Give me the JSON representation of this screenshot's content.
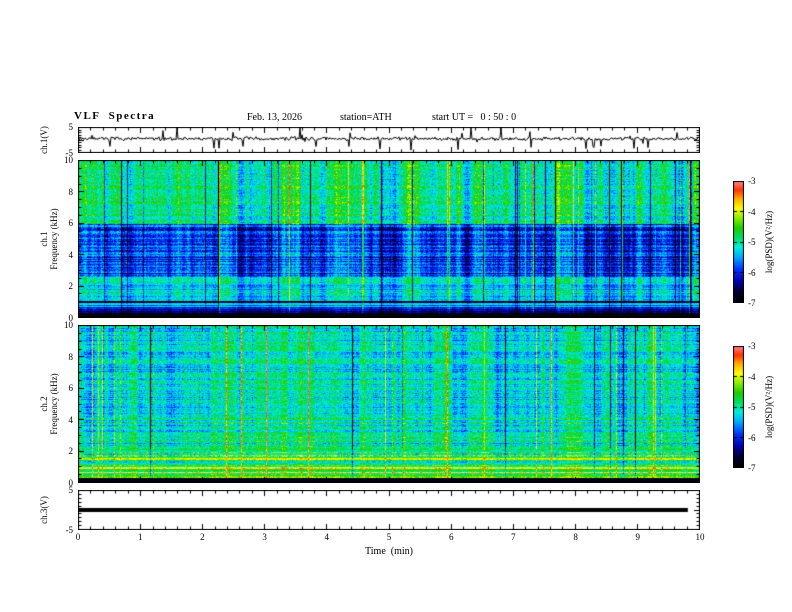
{
  "header": {
    "title": "VLF  Spectra",
    "date": "Feb. 13, 2026",
    "station": "station=ATH",
    "start_ut": "start UT =   0 : 50 : 0"
  },
  "axes": {
    "xlabel": "Time  (min)",
    "xlim": [
      0,
      10
    ],
    "xticks": [
      0,
      1,
      2,
      3,
      4,
      5,
      6,
      7,
      8,
      9,
      10
    ]
  },
  "colorbar": {
    "label": "log(PSD)(V²/Hz)",
    "ticks": [
      -3,
      -4,
      -5,
      -6,
      -7
    ],
    "zlim": [
      -7,
      -3
    ],
    "stops": [
      {
        "t": 0.0,
        "c": "#000000"
      },
      {
        "t": 0.1,
        "c": "#000033"
      },
      {
        "t": 0.18,
        "c": "#0000aa"
      },
      {
        "t": 0.28,
        "c": "#0033ff"
      },
      {
        "t": 0.38,
        "c": "#00aaff"
      },
      {
        "t": 0.46,
        "c": "#00eedd"
      },
      {
        "t": 0.54,
        "c": "#00e066"
      },
      {
        "t": 0.62,
        "c": "#22cc00"
      },
      {
        "t": 0.7,
        "c": "#88ee00"
      },
      {
        "t": 0.78,
        "c": "#ffff00"
      },
      {
        "t": 0.86,
        "c": "#ffaa00"
      },
      {
        "t": 0.93,
        "c": "#ff3300"
      },
      {
        "t": 1.0,
        "c": "#ff8888"
      }
    ]
  },
  "chart_data": [
    {
      "type": "line",
      "name": "ch1-voltage-waveform",
      "ylabel": "ch.1(V)",
      "ylim": [
        -5,
        5
      ],
      "yticks": [
        5,
        -5
      ],
      "xlim_min": [
        0,
        10
      ],
      "summary": "Noisy broadband voltage trace hovering near +0.5 V with frequent impulsive spikes (sferics) reaching toward +5 and -5 V across the full 10 minutes",
      "gen": {
        "seed": 7,
        "baseline": 0.5,
        "noise": 0.4,
        "spike_prob": 0.06,
        "spike_min": 1.2,
        "spike_max": 4.6,
        "neg_frac": 0.6
      }
    },
    {
      "type": "heatmap",
      "name": "ch1-spectrogram",
      "ylabel_lines": [
        "ch.1",
        "Frequency (kHz)"
      ],
      "ylim": [
        0,
        10
      ],
      "yticks": [
        0,
        2,
        4,
        6,
        8,
        10
      ],
      "zlim": [
        -7,
        -3
      ],
      "zlabel": "log(PSD)(V²/Hz)",
      "summary": "0-10 kHz spectrogram, 0-10 min: green band (~-5) above 6 kHz with dense vertical sferic striping (yellow bright / dark dropout columns), darker blue band (~-5.9) from ~2.5-6 kHz, cyan band (~-5.2) from ~1-2.5 kHz, mixed black and colored power-line harmonics below 1 kHz, near-black (~-7) floor under 0.35 kHz",
      "gen": {
        "seed": 21,
        "bands": [
          {
            "f0": 0.0,
            "f1": 0.35,
            "base": -6.9,
            "hvar": 0.1,
            "pvar": 0.05,
            "stripe": 0.1
          },
          {
            "f0": 0.35,
            "f1": 1.1,
            "base": -6.0,
            "hvar": 0.9,
            "pvar": 0.2,
            "stripe": 0.4
          },
          {
            "f0": 1.1,
            "f1": 2.6,
            "base": -5.25,
            "hvar": 0.35,
            "pvar": 0.25,
            "stripe": 0.8
          },
          {
            "f0": 2.6,
            "f1": 6.0,
            "base": -5.85,
            "hvar": 0.4,
            "pvar": 0.3,
            "stripe": 0.9
          },
          {
            "f0": 6.0,
            "f1": 10.0,
            "base": -4.95,
            "hvar": 0.25,
            "pvar": 0.3,
            "stripe": 1.0
          }
        ],
        "stripes": {
          "smooth": 0.18,
          "bright_prob": 0.035,
          "bright_amp": 1.0,
          "dark_prob": 0.05,
          "dark_amp": 1.6
        }
      }
    },
    {
      "type": "heatmap",
      "name": "ch2-spectrogram",
      "ylabel_lines": [
        "ch.2",
        "Frequency (kHz)"
      ],
      "ylim": [
        0,
        10
      ],
      "yticks": [
        0,
        2,
        4,
        6,
        8,
        10
      ],
      "zlim": [
        -7,
        -3
      ],
      "zlabel": "log(PSD)(V²/Hz)",
      "summary": "0-10 kHz spectrogram, 0-10 min: cyan-green field (~-5.2) above 4 kHz with vertical sferic striping and occasional bright yellow columns, green/cyan mix 2.2-4 kHz, strong layered yellow/orange/green horizontal harmonic lines (~-4.5) from ~0.4-2.2 kHz, near-black floor (~-6.8) below 0.35 kHz",
      "gen": {
        "seed": 31,
        "bands": [
          {
            "f0": 0.0,
            "f1": 0.35,
            "base": -6.8,
            "hvar": 0.15,
            "pvar": 0.05,
            "stripe": 0.1
          },
          {
            "f0": 0.35,
            "f1": 2.2,
            "base": -4.55,
            "hvar": 0.8,
            "pvar": 0.25,
            "stripe": 0.5
          },
          {
            "f0": 2.2,
            "f1": 4.2,
            "base": -5.05,
            "hvar": 0.45,
            "pvar": 0.3,
            "stripe": 0.9
          },
          {
            "f0": 4.2,
            "f1": 10.0,
            "base": -5.25,
            "hvar": 0.3,
            "pvar": 0.3,
            "stripe": 1.0
          }
        ],
        "stripes": {
          "smooth": 0.15,
          "bright_prob": 0.045,
          "bright_amp": 1.1,
          "dark_prob": 0.03,
          "dark_amp": 1.3
        }
      }
    },
    {
      "type": "line",
      "name": "ch3-voltage-waveform",
      "ylabel": "ch.3(V)",
      "ylim": [
        -5,
        5
      ],
      "yticks": [
        5,
        -5
      ],
      "summary": "Flat constant trace at ~0 V drawn as a thick black bar spanning from t=0 to about t=9.8 min (no signal on channel 3)",
      "gen": {
        "flat_value": 0,
        "thickness_px": 4,
        "x_end_frac": 0.982
      }
    }
  ]
}
